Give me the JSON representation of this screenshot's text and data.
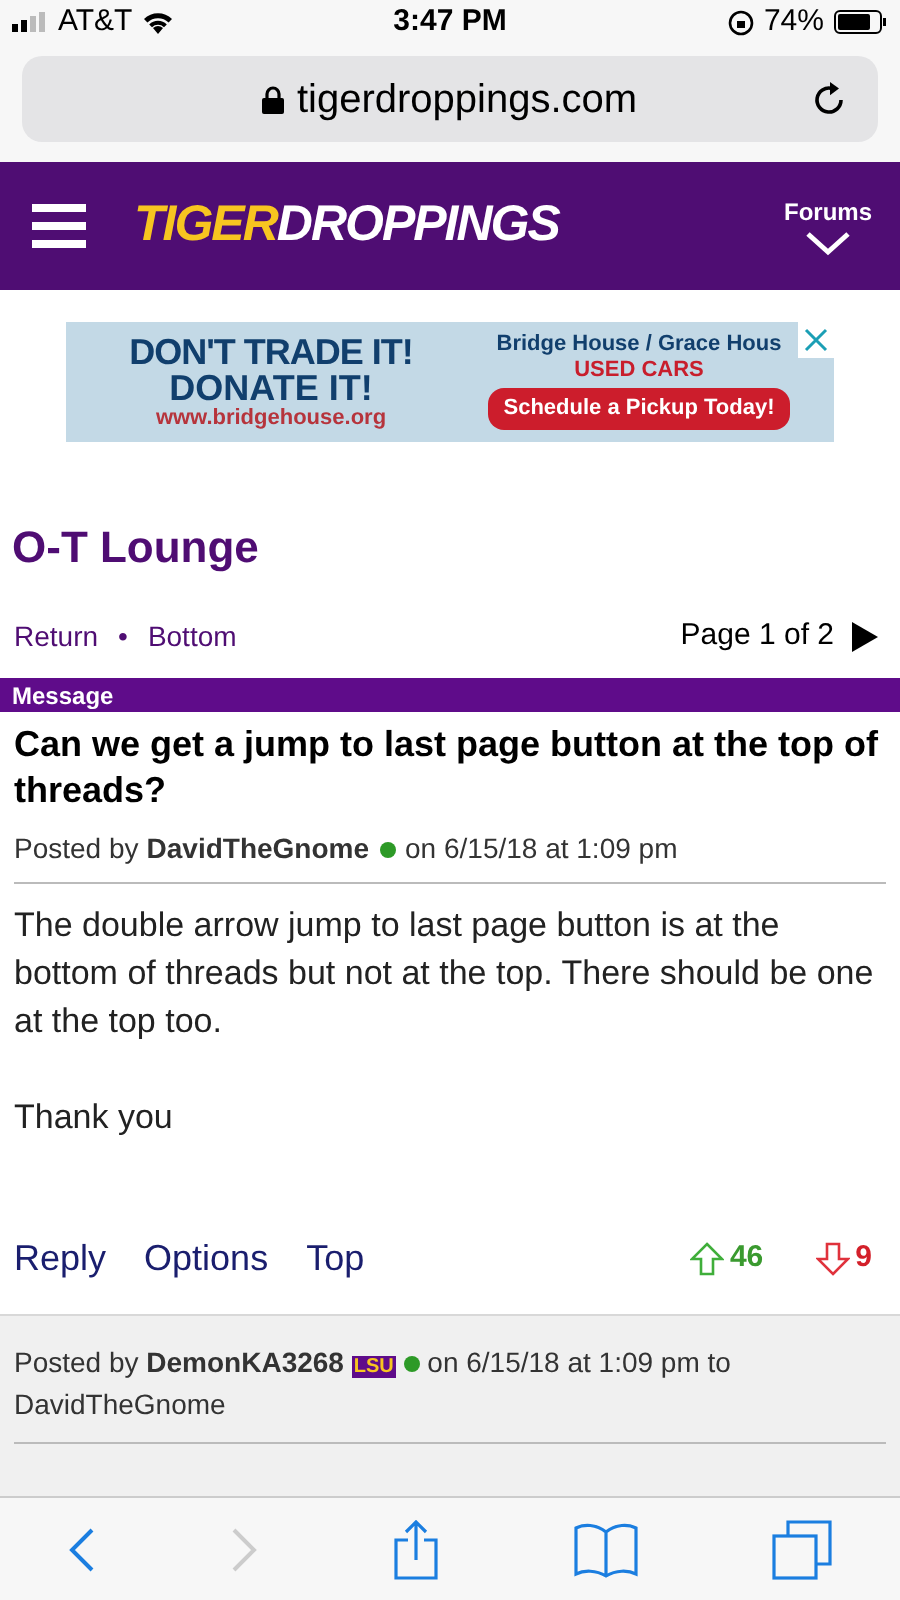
{
  "status_bar": {
    "carrier": "AT&T",
    "time": "3:47 PM",
    "battery": "74%"
  },
  "address_bar": {
    "url": "tigerdroppings.com"
  },
  "header": {
    "logo_part_1": "TIGER",
    "logo_part_2": "DROPPINGS",
    "forums_label": "Forums"
  },
  "ad": {
    "headline_1": "DON'T TRADE IT!",
    "headline_2": "DONATE IT!",
    "website": "www.bridgehouse.org",
    "sponsor": "Bridge House / Grace Hous",
    "subhead": "USED CARS",
    "cta": "Schedule a Pickup Today!"
  },
  "forum_title": "O-T Lounge",
  "nav": {
    "links": [
      "Return",
      "Bottom"
    ],
    "separator": "•",
    "page": "Page 1 of 2"
  },
  "message_bar": "Message",
  "post": {
    "title": "Can we get a jump to last page button at the top of threads?",
    "posted_by": "Posted by",
    "author": "DavidTheGnome",
    "date": "on 6/15/18 at 1:09 pm",
    "paragraphs": [
      "The double arrow jump to last page button is at the bottom of threads but not at the top. There should be one at the top too.",
      "Thank you"
    ],
    "actions": [
      "Reply",
      "Options",
      "Top"
    ],
    "upvotes": "46",
    "downvotes": "9"
  },
  "reply": {
    "posted_by": "Posted by",
    "author": "DemonKA3268",
    "badge": "LSU",
    "date": "on 6/15/18 at 1:09 pm to",
    "to": "DavidTheGnome"
  }
}
